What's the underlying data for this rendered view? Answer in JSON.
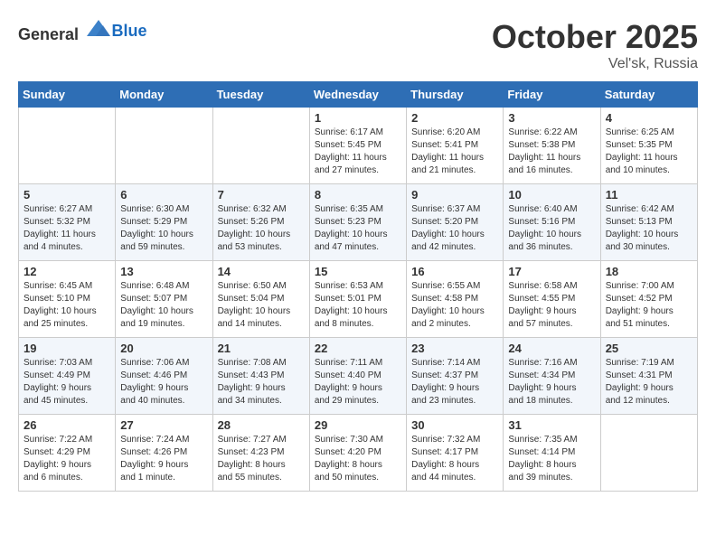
{
  "header": {
    "logo_general": "General",
    "logo_blue": "Blue",
    "month_title": "October 2025",
    "location": "Vel'sk, Russia"
  },
  "days_of_week": [
    "Sunday",
    "Monday",
    "Tuesday",
    "Wednesday",
    "Thursday",
    "Friday",
    "Saturday"
  ],
  "weeks": [
    [
      {
        "day": "",
        "content": ""
      },
      {
        "day": "",
        "content": ""
      },
      {
        "day": "",
        "content": ""
      },
      {
        "day": "1",
        "content": "Sunrise: 6:17 AM\nSunset: 5:45 PM\nDaylight: 11 hours\nand 27 minutes."
      },
      {
        "day": "2",
        "content": "Sunrise: 6:20 AM\nSunset: 5:41 PM\nDaylight: 11 hours\nand 21 minutes."
      },
      {
        "day": "3",
        "content": "Sunrise: 6:22 AM\nSunset: 5:38 PM\nDaylight: 11 hours\nand 16 minutes."
      },
      {
        "day": "4",
        "content": "Sunrise: 6:25 AM\nSunset: 5:35 PM\nDaylight: 11 hours\nand 10 minutes."
      }
    ],
    [
      {
        "day": "5",
        "content": "Sunrise: 6:27 AM\nSunset: 5:32 PM\nDaylight: 11 hours\nand 4 minutes."
      },
      {
        "day": "6",
        "content": "Sunrise: 6:30 AM\nSunset: 5:29 PM\nDaylight: 10 hours\nand 59 minutes."
      },
      {
        "day": "7",
        "content": "Sunrise: 6:32 AM\nSunset: 5:26 PM\nDaylight: 10 hours\nand 53 minutes."
      },
      {
        "day": "8",
        "content": "Sunrise: 6:35 AM\nSunset: 5:23 PM\nDaylight: 10 hours\nand 47 minutes."
      },
      {
        "day": "9",
        "content": "Sunrise: 6:37 AM\nSunset: 5:20 PM\nDaylight: 10 hours\nand 42 minutes."
      },
      {
        "day": "10",
        "content": "Sunrise: 6:40 AM\nSunset: 5:16 PM\nDaylight: 10 hours\nand 36 minutes."
      },
      {
        "day": "11",
        "content": "Sunrise: 6:42 AM\nSunset: 5:13 PM\nDaylight: 10 hours\nand 30 minutes."
      }
    ],
    [
      {
        "day": "12",
        "content": "Sunrise: 6:45 AM\nSunset: 5:10 PM\nDaylight: 10 hours\nand 25 minutes."
      },
      {
        "day": "13",
        "content": "Sunrise: 6:48 AM\nSunset: 5:07 PM\nDaylight: 10 hours\nand 19 minutes."
      },
      {
        "day": "14",
        "content": "Sunrise: 6:50 AM\nSunset: 5:04 PM\nDaylight: 10 hours\nand 14 minutes."
      },
      {
        "day": "15",
        "content": "Sunrise: 6:53 AM\nSunset: 5:01 PM\nDaylight: 10 hours\nand 8 minutes."
      },
      {
        "day": "16",
        "content": "Sunrise: 6:55 AM\nSunset: 4:58 PM\nDaylight: 10 hours\nand 2 minutes."
      },
      {
        "day": "17",
        "content": "Sunrise: 6:58 AM\nSunset: 4:55 PM\nDaylight: 9 hours\nand 57 minutes."
      },
      {
        "day": "18",
        "content": "Sunrise: 7:00 AM\nSunset: 4:52 PM\nDaylight: 9 hours\nand 51 minutes."
      }
    ],
    [
      {
        "day": "19",
        "content": "Sunrise: 7:03 AM\nSunset: 4:49 PM\nDaylight: 9 hours\nand 45 minutes."
      },
      {
        "day": "20",
        "content": "Sunrise: 7:06 AM\nSunset: 4:46 PM\nDaylight: 9 hours\nand 40 minutes."
      },
      {
        "day": "21",
        "content": "Sunrise: 7:08 AM\nSunset: 4:43 PM\nDaylight: 9 hours\nand 34 minutes."
      },
      {
        "day": "22",
        "content": "Sunrise: 7:11 AM\nSunset: 4:40 PM\nDaylight: 9 hours\nand 29 minutes."
      },
      {
        "day": "23",
        "content": "Sunrise: 7:14 AM\nSunset: 4:37 PM\nDaylight: 9 hours\nand 23 minutes."
      },
      {
        "day": "24",
        "content": "Sunrise: 7:16 AM\nSunset: 4:34 PM\nDaylight: 9 hours\nand 18 minutes."
      },
      {
        "day": "25",
        "content": "Sunrise: 7:19 AM\nSunset: 4:31 PM\nDaylight: 9 hours\nand 12 minutes."
      }
    ],
    [
      {
        "day": "26",
        "content": "Sunrise: 7:22 AM\nSunset: 4:29 PM\nDaylight: 9 hours\nand 6 minutes."
      },
      {
        "day": "27",
        "content": "Sunrise: 7:24 AM\nSunset: 4:26 PM\nDaylight: 9 hours\nand 1 minute."
      },
      {
        "day": "28",
        "content": "Sunrise: 7:27 AM\nSunset: 4:23 PM\nDaylight: 8 hours\nand 55 minutes."
      },
      {
        "day": "29",
        "content": "Sunrise: 7:30 AM\nSunset: 4:20 PM\nDaylight: 8 hours\nand 50 minutes."
      },
      {
        "day": "30",
        "content": "Sunrise: 7:32 AM\nSunset: 4:17 PM\nDaylight: 8 hours\nand 44 minutes."
      },
      {
        "day": "31",
        "content": "Sunrise: 7:35 AM\nSunset: 4:14 PM\nDaylight: 8 hours\nand 39 minutes."
      },
      {
        "day": "",
        "content": ""
      }
    ]
  ]
}
